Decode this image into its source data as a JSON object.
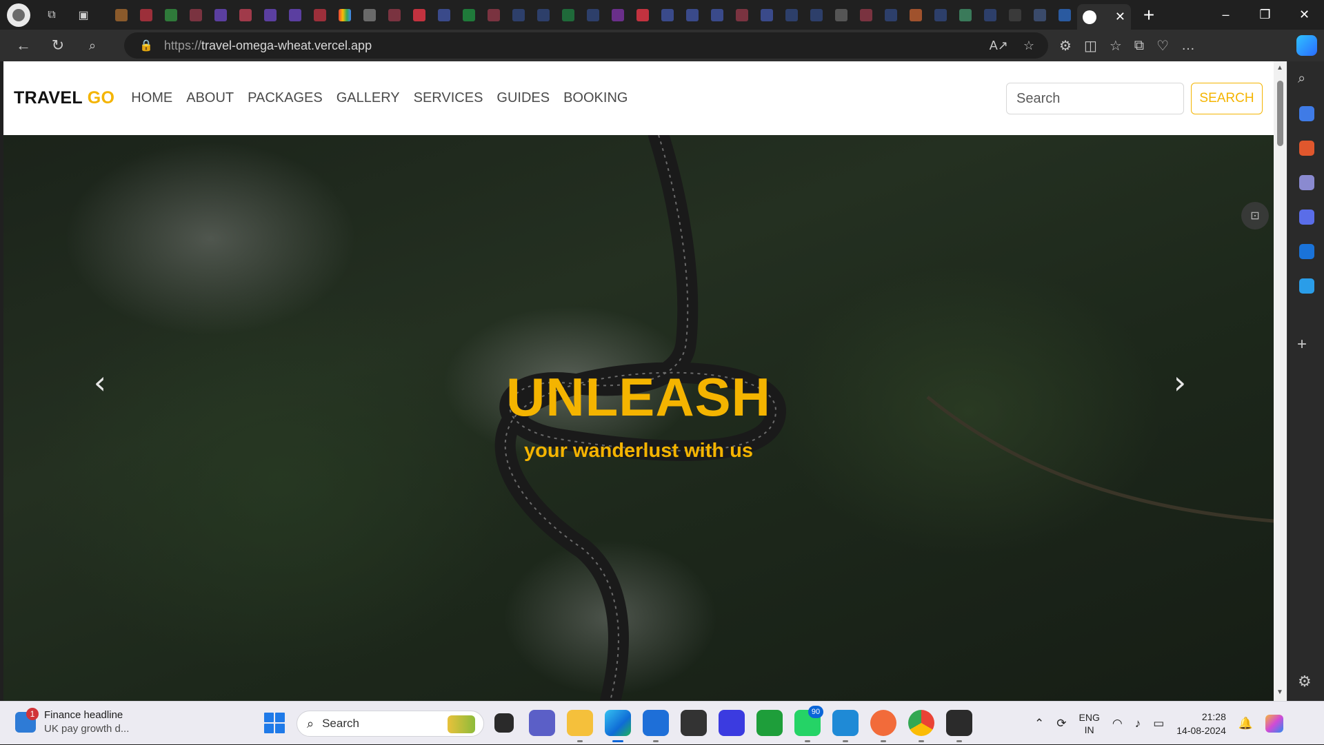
{
  "browser": {
    "tab_close_glyph": "✕",
    "new_tab_glyph": "+",
    "url_scheme": "https://",
    "url_host": "travel-omega-wheat.vercel.app",
    "window_controls": [
      "–",
      "❐",
      "✕"
    ]
  },
  "site": {
    "brand_main": "TRAVEL",
    "brand_accent": "GO",
    "accent_color": "#f4b400",
    "nav": [
      "HOME",
      "ABOUT",
      "PACKAGES",
      "GALLERY",
      "SERVICES",
      "GUIDES",
      "BOOKING"
    ],
    "search_placeholder": "Search",
    "search_button": "SEARCH",
    "hero_title": "UNLEASH",
    "hero_subtitle": "your wanderlust with us",
    "prev_glyph": "‹",
    "next_glyph": "›"
  },
  "taskbar": {
    "news_title": "Finance headline",
    "news_subtitle": "UK pay growth d...",
    "news_badge": "1",
    "search_label": "Search",
    "whatsapp_badge": "90",
    "lang_top": "ENG",
    "lang_bottom": "IN",
    "time": "21:28",
    "date": "14-08-2024"
  }
}
